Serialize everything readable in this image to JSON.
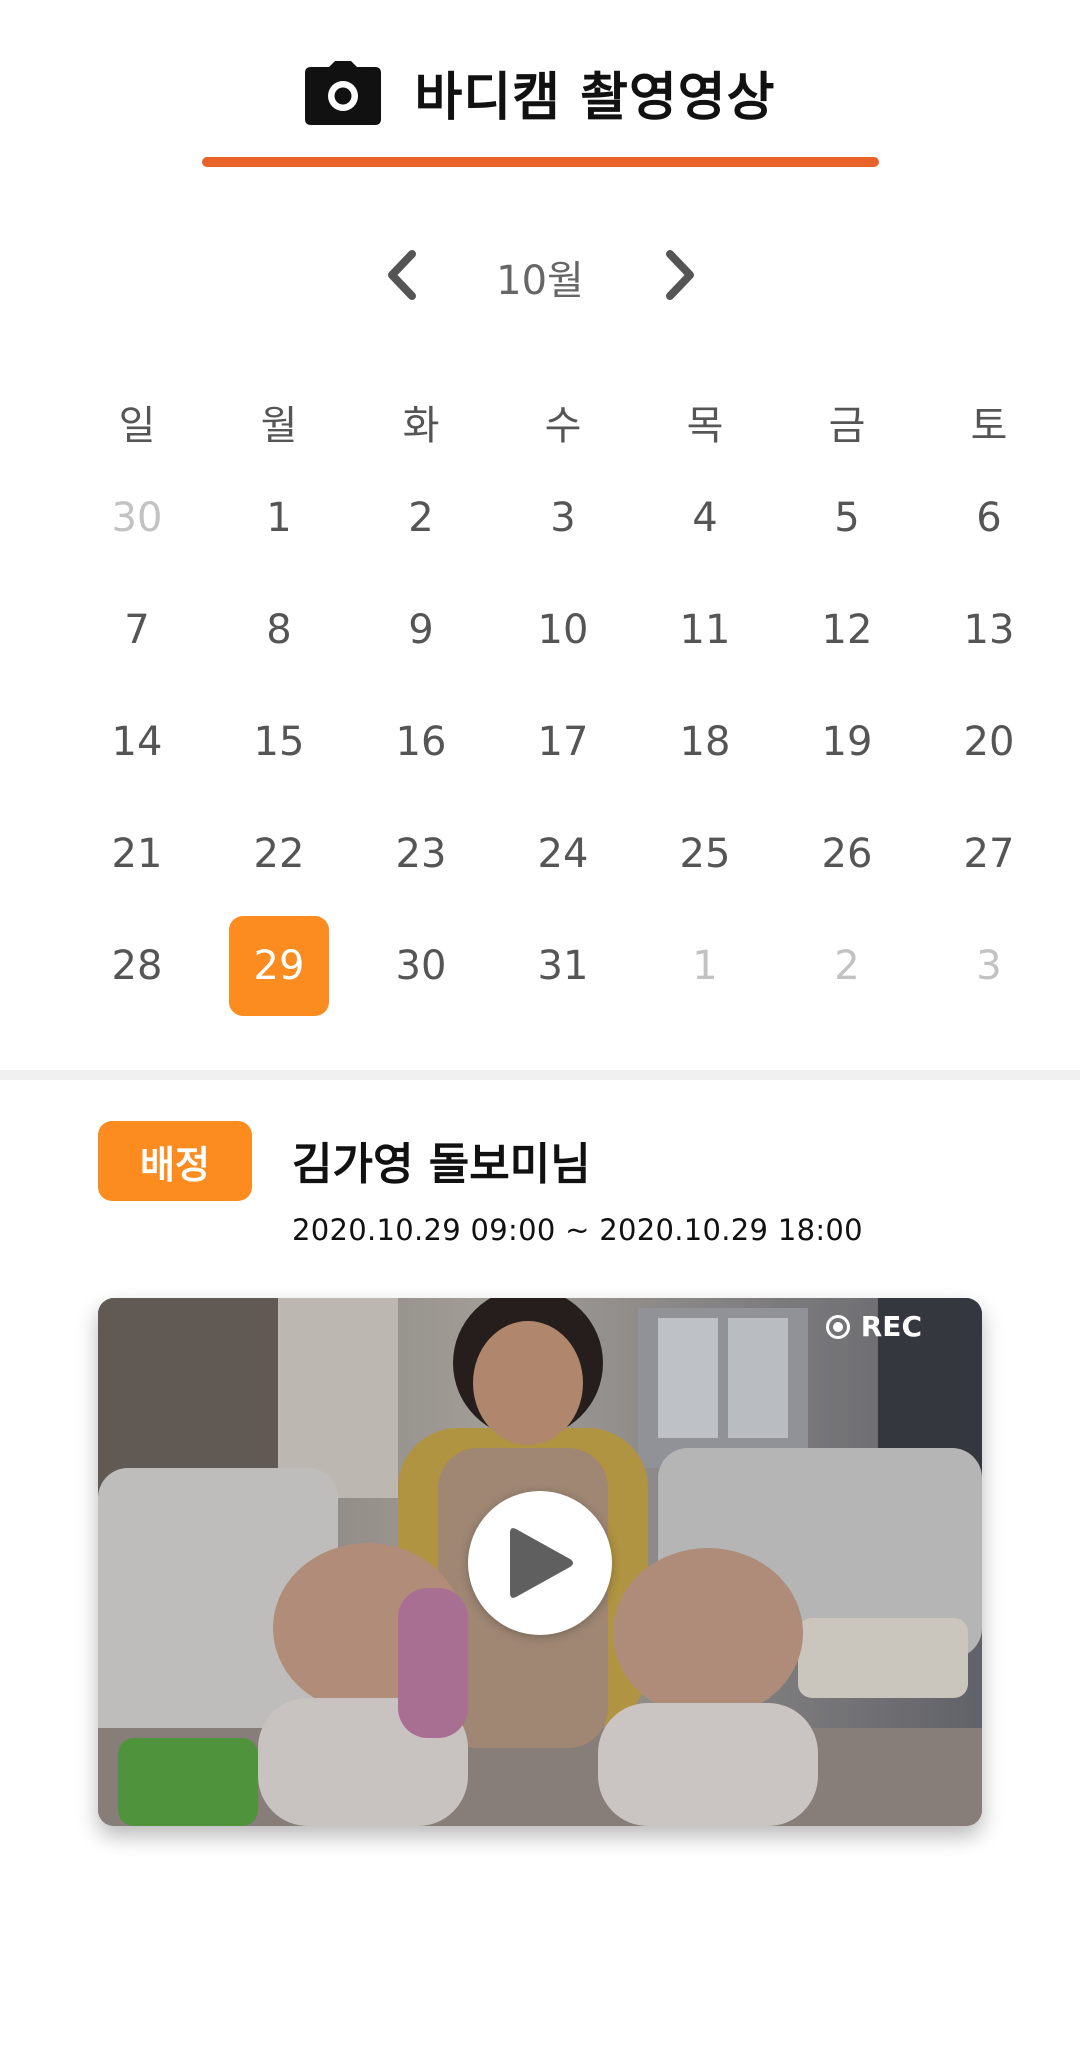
{
  "header": {
    "title": "바디캠 촬영영상",
    "icon": "camera-icon",
    "accent_color": "#e8632a"
  },
  "calendar": {
    "month_label": "10월",
    "prev_icon": "chevron-left-icon",
    "next_icon": "chevron-right-icon",
    "weekdays": [
      "일",
      "월",
      "화",
      "수",
      "목",
      "금",
      "토"
    ],
    "weeks": [
      [
        {
          "label": "30",
          "other_month": true
        },
        {
          "label": "1"
        },
        {
          "label": "2"
        },
        {
          "label": "3"
        },
        {
          "label": "4"
        },
        {
          "label": "5"
        },
        {
          "label": "6"
        }
      ],
      [
        {
          "label": "7"
        },
        {
          "label": "8"
        },
        {
          "label": "9"
        },
        {
          "label": "10"
        },
        {
          "label": "11"
        },
        {
          "label": "12"
        },
        {
          "label": "13"
        }
      ],
      [
        {
          "label": "14"
        },
        {
          "label": "15"
        },
        {
          "label": "16"
        },
        {
          "label": "17"
        },
        {
          "label": "18"
        },
        {
          "label": "19"
        },
        {
          "label": "20"
        }
      ],
      [
        {
          "label": "21"
        },
        {
          "label": "22"
        },
        {
          "label": "23"
        },
        {
          "label": "24"
        },
        {
          "label": "25"
        },
        {
          "label": "26"
        },
        {
          "label": "27"
        }
      ],
      [
        {
          "label": "28"
        },
        {
          "label": "29",
          "selected": true
        },
        {
          "label": "30"
        },
        {
          "label": "31"
        },
        {
          "label": "1",
          "other_month": true
        },
        {
          "label": "2",
          "other_month": true
        },
        {
          "label": "3",
          "other_month": true
        }
      ]
    ],
    "selected_color": "#fd8c20"
  },
  "assignment": {
    "badge_label": "배정",
    "sitter_name": "김가영 돌보미님",
    "time_range": "2020.10.29 09:00 ~ 2020.10.29 18:00"
  },
  "video": {
    "rec_label": "REC",
    "rec_icon": "record-icon",
    "play_icon": "play-icon"
  }
}
